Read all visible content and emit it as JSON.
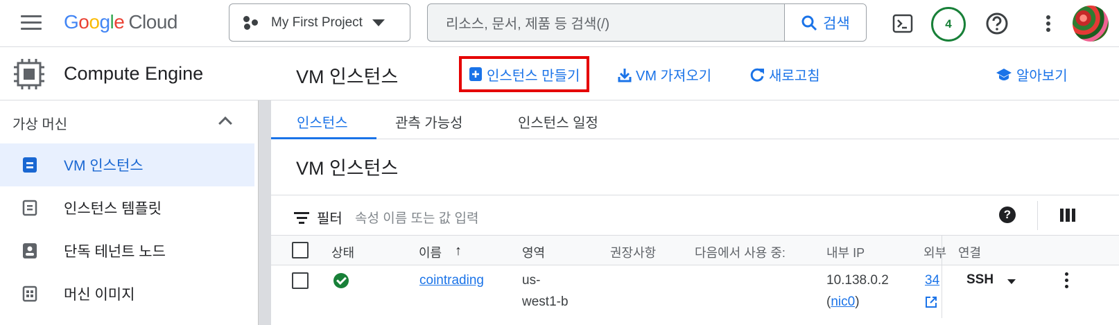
{
  "topbar": {
    "logo_letters": [
      "G",
      "o",
      "o",
      "g",
      "l",
      "e"
    ],
    "logo_suffix": "Cloud",
    "project_name": "My First Project",
    "search_placeholder": "리소스, 문서, 제품 등 검색(/)",
    "search_button": "검색",
    "notification_count": "4"
  },
  "sidebar": {
    "product_title": "Compute Engine",
    "section_label": "가상 머신",
    "items": [
      {
        "label": "VM 인스턴스",
        "active": true
      },
      {
        "label": "인스턴스 템플릿",
        "active": false
      },
      {
        "label": "단독 테넌트 노드",
        "active": false
      },
      {
        "label": "머신 이미지",
        "active": false
      }
    ]
  },
  "header": {
    "title": "VM 인스턴스",
    "actions": {
      "create_instance": "인스턴스 만들기",
      "import_vm": "VM 가져오기",
      "refresh": "새로고침",
      "learn": "알아보기"
    }
  },
  "tabs": [
    "인스턴스",
    "관측 가능성",
    "인스턴스 일정"
  ],
  "section_title": "VM 인스턴스",
  "filter": {
    "label": "필터",
    "placeholder": "속성 이름 또는 값 입력"
  },
  "table": {
    "columns": [
      "상태",
      "이름",
      "영역",
      "권장사항",
      "다음에서 사용 중:",
      "내부 IP",
      "외부",
      "연결"
    ],
    "rows": [
      {
        "status": "running",
        "name": "cointrading",
        "zone_line1": "us-",
        "zone_line2": "west1-b",
        "internal_ip": "10.138.0.2",
        "nic_open": "(",
        "nic": "nic0",
        "nic_close": ")",
        "external_ip": "34",
        "connect": "SSH"
      }
    ]
  },
  "colors": {
    "accent": "#1a73e8",
    "highlight_box": "#e50000",
    "status_ok": "#188038",
    "active_bg": "#e8f0fe"
  }
}
